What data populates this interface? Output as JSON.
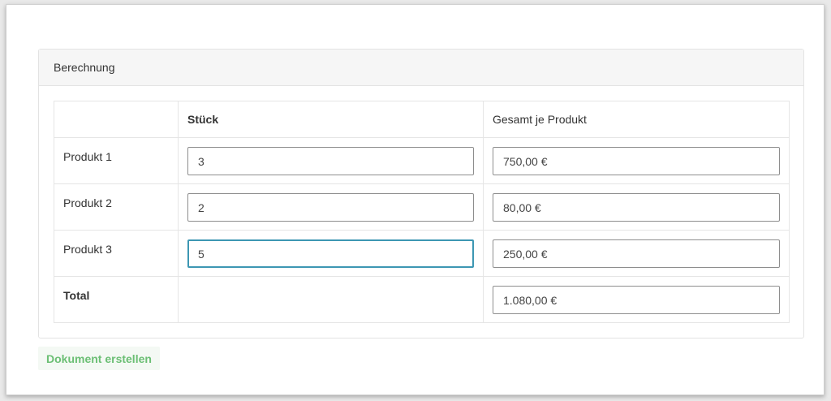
{
  "panel": {
    "title": "Berechnung"
  },
  "table": {
    "headers": {
      "label": "",
      "quantity": "Stück",
      "total": "Gesamt je Produkt"
    },
    "rows": [
      {
        "label": "Produkt 1",
        "quantity": "3",
        "total": "750,00 €"
      },
      {
        "label": "Produkt 2",
        "quantity": "2",
        "total": "80,00 €"
      },
      {
        "label": "Produkt 3",
        "quantity": "5",
        "total": "250,00 €"
      }
    ],
    "total_row": {
      "label": "Total",
      "total": "1.080,00 €"
    }
  },
  "actions": {
    "create_document_label": "Dokument erstellen"
  },
  "colors": {
    "focus_border": "#3d97b3",
    "button_text": "#6bbf74",
    "button_background": "#f4f9f4"
  }
}
